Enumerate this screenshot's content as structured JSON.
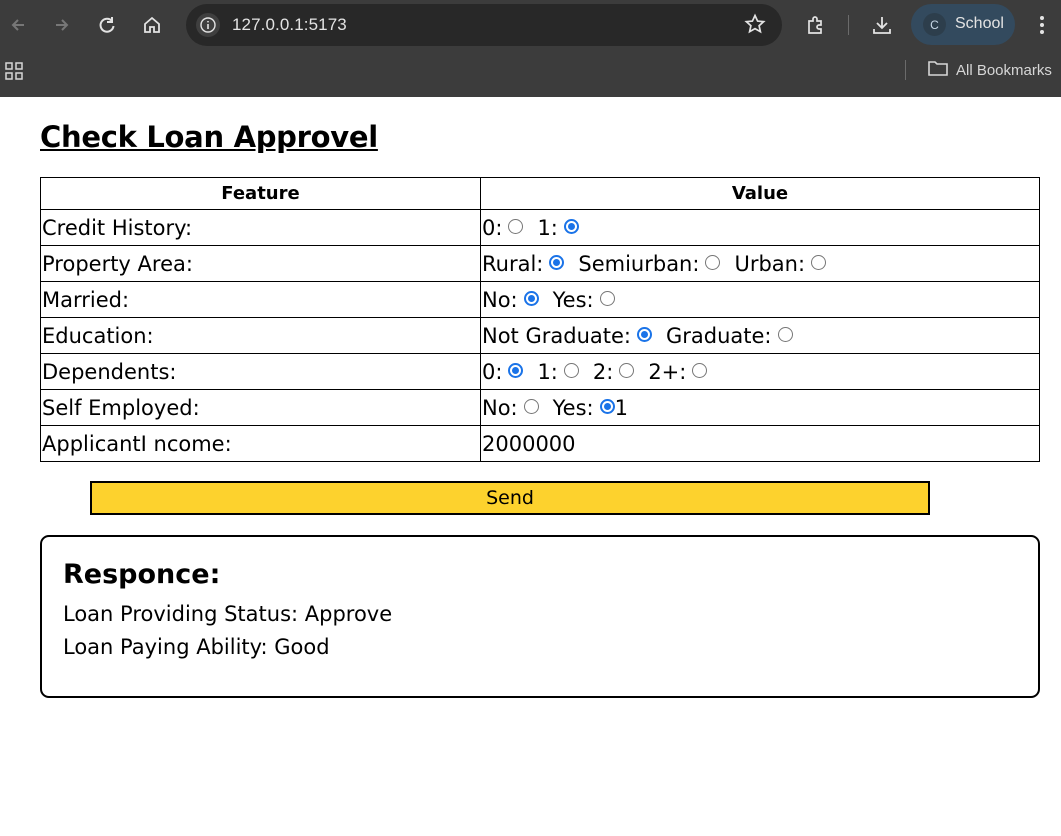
{
  "browser": {
    "url": "127.0.0.1:5173",
    "profile_initial": "C",
    "profile_name": "School",
    "all_bookmarks": "All Bookmarks"
  },
  "page": {
    "title": "Check Loan Approvel",
    "table": {
      "headers": [
        "Feature",
        "Value"
      ],
      "rows": [
        {
          "feature": "Credit History:",
          "options": [
            {
              "label": "0:",
              "checked": false
            },
            {
              "label": "1:",
              "checked": true
            }
          ]
        },
        {
          "feature": "Property Area:",
          "options": [
            {
              "label": "Rural:",
              "checked": true
            },
            {
              "label": "Semiurban:",
              "checked": false
            },
            {
              "label": "Urban:",
              "checked": false
            }
          ]
        },
        {
          "feature": "Married:",
          "options": [
            {
              "label": "No:",
              "checked": true
            },
            {
              "label": "Yes:",
              "checked": false
            }
          ]
        },
        {
          "feature": "Education:",
          "options": [
            {
              "label": "Not Graduate:",
              "checked": true
            },
            {
              "label": "Graduate:",
              "checked": false
            }
          ]
        },
        {
          "feature": "Dependents:",
          "options": [
            {
              "label": "0:",
              "checked": true
            },
            {
              "label": "1:",
              "checked": false
            },
            {
              "label": "2:",
              "checked": false
            },
            {
              "label": "2+:",
              "checked": false
            }
          ]
        },
        {
          "feature": "Self Employed:",
          "options": [
            {
              "label": "No:",
              "checked": false
            },
            {
              "label": "Yes:",
              "checked": true
            }
          ],
          "suffix": "1"
        },
        {
          "feature": "ApplicantI ncome:",
          "value": "2000000"
        }
      ]
    },
    "send_label": "Send",
    "response": {
      "heading": "Responce:",
      "status_line": "Loan Providing Status: Approve",
      "ability_line": "Loan Paying Ability: Good"
    }
  },
  "colors": {
    "chrome_bg": "#3c3c3c",
    "send_button": "#fdd22d",
    "radio_accent": "#1a73e8"
  }
}
